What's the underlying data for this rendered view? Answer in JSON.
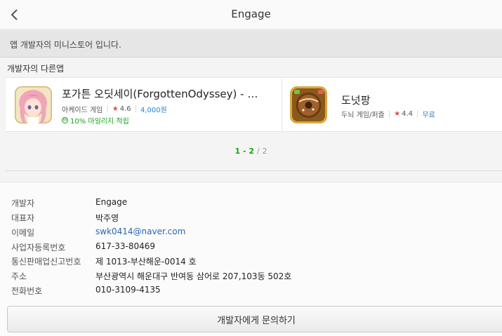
{
  "header": {
    "title": "Engage",
    "back_icon": "chevron-left-icon"
  },
  "notice": "앱 개발자의 미니스토어 입니다.",
  "section_label": "개발자의 다른앱",
  "apps": [
    {
      "name": "포가튼 오딧세이(ForgottenOdyssey) - 미소녀 RPG",
      "category": "아케이드 게임",
      "rating": "4.6",
      "price": "4,000원",
      "mileage": "10% 마일리지 적립",
      "icon": "anime-girl-app-icon"
    },
    {
      "name": "도넛팡",
      "category": "두뇌 게임/퍼즐",
      "rating": "4.4",
      "price": "무료",
      "icon": "donut-app-icon"
    }
  ],
  "pager": {
    "current": "1 - 2",
    "separator": "/",
    "total": "2"
  },
  "developer_info": [
    {
      "key": "개발자",
      "value": "Engage"
    },
    {
      "key": "대표자",
      "value": "박주영"
    },
    {
      "key": "이메일",
      "value": "swk0414@naver.com"
    },
    {
      "key": "사업자등록번호",
      "value": "617-33-80469"
    },
    {
      "key": "통신판매업신고번호",
      "value": "제 1013-부산해운-0014 호"
    },
    {
      "key": "주소",
      "value": "부산광역시 해운대구 반여동 삼어로 207,103동 502호"
    },
    {
      "key": "전화번호",
      "value": "010-3109-4135"
    }
  ],
  "contact_button": "개발자에게 문의하기",
  "colors": {
    "accent_green": "#19a317",
    "price_blue": "#2a7fd0",
    "star_red": "#e04b4b",
    "link_blue": "#2b65b8"
  }
}
